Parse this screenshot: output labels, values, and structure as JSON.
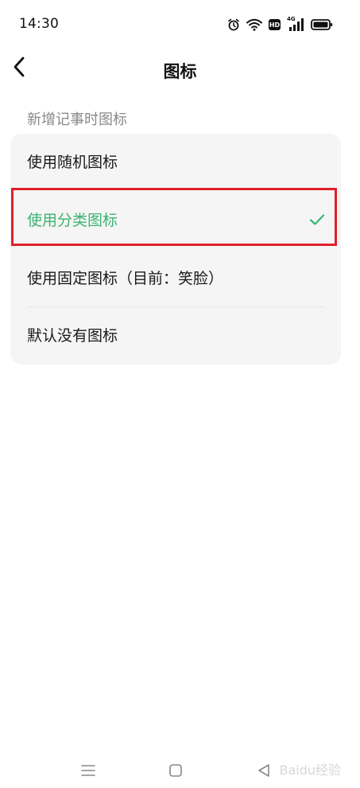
{
  "status_bar": {
    "time": "14:30",
    "hd_badge": "HD",
    "signal_label": "4G"
  },
  "header": {
    "title": "图标"
  },
  "section": {
    "label": "新增记事时图标"
  },
  "options": [
    {
      "label": "使用随机图标",
      "selected": false
    },
    {
      "label": "使用分类图标",
      "selected": true
    },
    {
      "label": "使用固定图标（目前：笑脸）",
      "selected": false
    },
    {
      "label": "默认没有图标",
      "selected": false
    }
  ],
  "colors": {
    "accent": "#3cb371",
    "highlight": "#e0202a",
    "card": "#f5f5f5"
  },
  "nav": {
    "icons": [
      "menu-icon",
      "home-square-icon",
      "back-triangle-icon"
    ]
  },
  "watermark": "Baidu经验"
}
